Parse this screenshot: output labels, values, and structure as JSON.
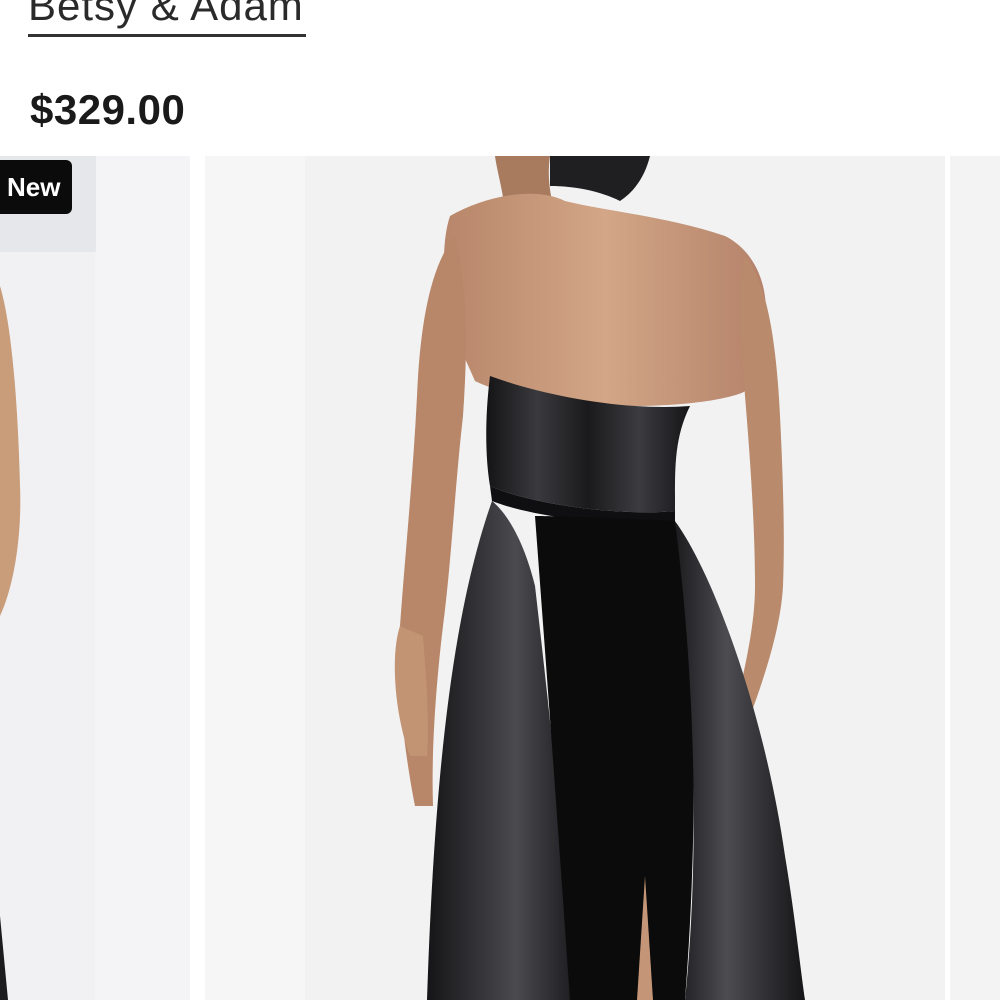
{
  "product": {
    "brand": "Betsy & Adam",
    "price": "$329.00"
  },
  "gallery": {
    "badge": "New",
    "images": [
      {
        "label": "product-image-front",
        "icon": "dress-photo"
      },
      {
        "label": "product-image-back",
        "icon": "dress-photo"
      },
      {
        "label": "product-image-next",
        "icon": "dress-photo"
      }
    ]
  },
  "colors": {
    "dress": "#1c1c1e",
    "skin": "#c79a78",
    "background": "#f2f2f3"
  }
}
